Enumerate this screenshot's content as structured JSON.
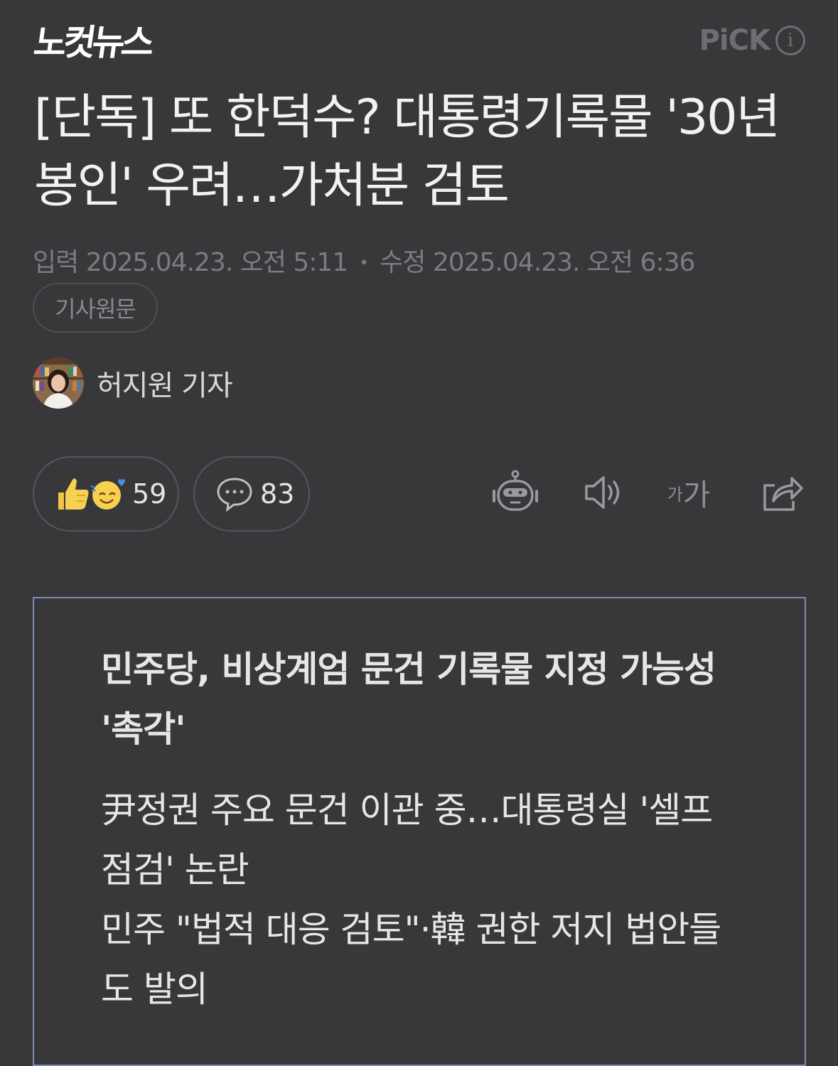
{
  "header": {
    "logo_text": "노컷뉴스",
    "pick_label": "PiCK",
    "pick_info_glyph": "i"
  },
  "article": {
    "headline": "[단독] 또 한덕수? 대통령기록물 '30년 봉인' 우려…가처분 검토",
    "input_label": "입력",
    "input_datetime": "2025.04.23. 오전 5:11",
    "separator": "•",
    "modified_label": "수정",
    "modified_datetime": "2025.04.23. 오전 6:36",
    "original_button": "기사원문",
    "author": "허지원 기자"
  },
  "actions": {
    "reaction_count": "59",
    "comment_count": "83",
    "font_size_small": "가",
    "font_size_big": "가",
    "icons": [
      "summary-bot-icon",
      "speaker-icon",
      "font-size-icon",
      "share-icon"
    ]
  },
  "summary": {
    "title": "민주당, 비상계엄 문건 기록물 지정 가능성 '촉각'",
    "lines": [
      "尹정권 주요 문건 이관 중…대통령실 '셀프",
      "점검' 논란",
      "민주 \"법적 대응 검토\"·韓 권한 저지 법안들",
      "도 발의"
    ]
  },
  "colors": {
    "background": "#38383b",
    "box_border": "#7f8bb5",
    "muted_text": "#7c7c80"
  }
}
